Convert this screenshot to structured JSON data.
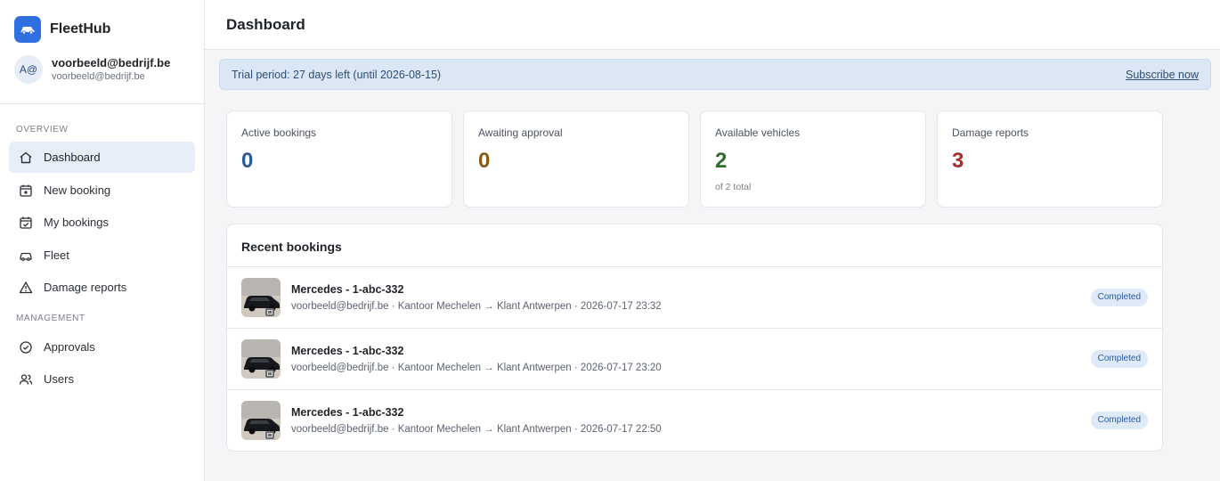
{
  "brand": {
    "name": "FleetHub",
    "logo_icon": "car-icon",
    "accent": "#2f6fe0"
  },
  "user": {
    "initials": "A@",
    "name": "voorbeeld@bedrijf.be",
    "email": "voorbeeld@bedrijf.be"
  },
  "sidebar": {
    "sections": [
      {
        "label": "OVERVIEW",
        "items": [
          {
            "label": "Dashboard",
            "icon": "home-icon",
            "active": true
          },
          {
            "label": "New booking",
            "icon": "calendar-plus-icon"
          },
          {
            "label": "My bookings",
            "icon": "calendar-check-icon"
          },
          {
            "label": "Fleet",
            "icon": "car-icon"
          },
          {
            "label": "Damage reports",
            "icon": "warning-icon"
          }
        ]
      },
      {
        "label": "MANAGEMENT",
        "items": [
          {
            "label": "Approvals",
            "icon": "check-circle-icon"
          },
          {
            "label": "Users",
            "icon": "users-icon"
          }
        ]
      }
    ]
  },
  "header": {
    "title": "Dashboard"
  },
  "trial": {
    "text": "Trial period: 27 days left (until 2026-08-15)",
    "link": "Subscribe now"
  },
  "stats": [
    {
      "label": "Active bookings",
      "value": "0",
      "color": "#2b5a99"
    },
    {
      "label": "Awaiting approval",
      "value": "0",
      "color": "#8a5a12"
    },
    {
      "label": "Available vehicles",
      "value": "2",
      "sub": "of 2 total",
      "color": "#2f6b2a"
    },
    {
      "label": "Damage reports",
      "value": "3",
      "color": "#a3302f"
    }
  ],
  "recent": {
    "title": "Recent bookings",
    "rows": [
      {
        "title": "Mercedes - 1-abc-332",
        "meta": "voorbeeld@bedrijf.be · Kantoor Mechelen → Klant Antwerpen · 2026-07-17 23:32",
        "status": "Completed"
      },
      {
        "title": "Mercedes - 1-abc-332",
        "meta": "voorbeeld@bedrijf.be · Kantoor Mechelen → Klant Antwerpen · 2026-07-17 23:20",
        "status": "Completed"
      },
      {
        "title": "Mercedes - 1-abc-332",
        "meta": "voorbeeld@bedrijf.be · Kantoor Mechelen → Klant Antwerpen · 2026-07-17 22:50",
        "status": "Completed"
      }
    ]
  }
}
